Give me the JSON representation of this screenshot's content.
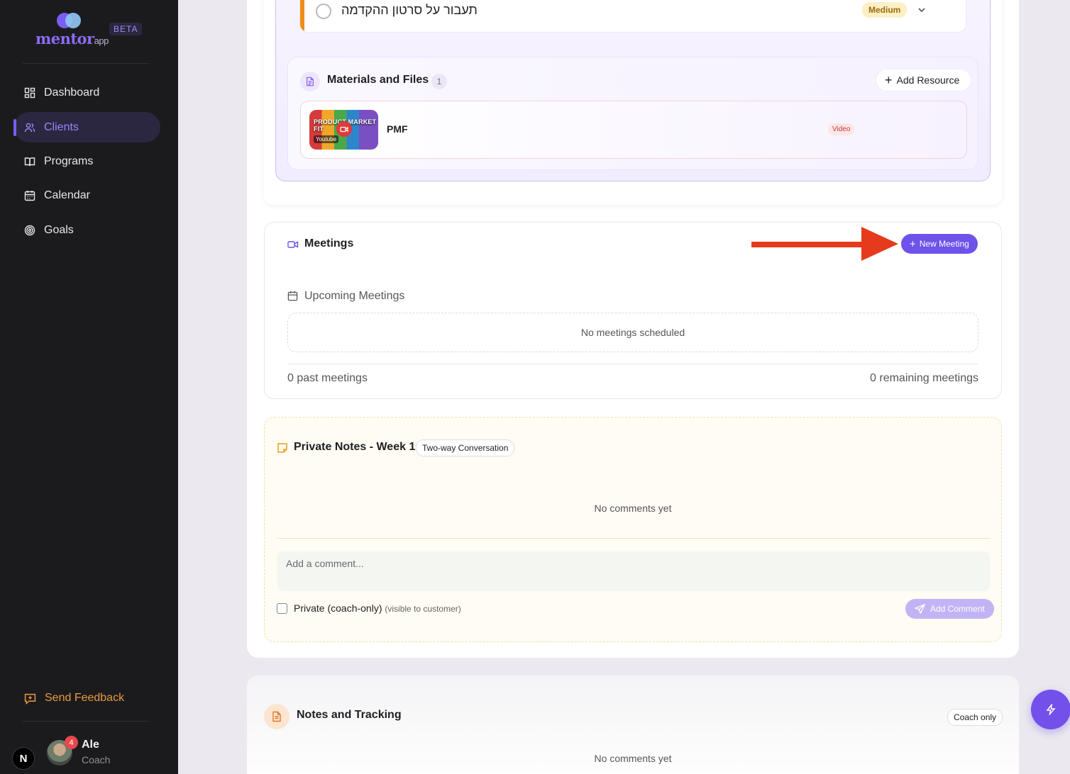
{
  "sidebar": {
    "logo": {
      "brand": "mentor",
      "suffix": "app"
    },
    "beta_label": "BETA",
    "items": [
      {
        "label": "Dashboard",
        "icon": "dashboard-icon",
        "active": false
      },
      {
        "label": "Clients",
        "icon": "users-icon",
        "active": true
      },
      {
        "label": "Programs",
        "icon": "book-icon",
        "active": false
      },
      {
        "label": "Calendar",
        "icon": "calendar-icon",
        "active": false
      },
      {
        "label": "Goals",
        "icon": "target-icon",
        "active": false
      }
    ],
    "feedback_label": "Send Feedback",
    "user": {
      "name": "Ale",
      "role": "Coach",
      "notifications": "4"
    },
    "framework_mark": "N"
  },
  "task": {
    "title": "תעבור על סרטון ההקדמה",
    "priority": "Medium"
  },
  "materials": {
    "title": "Materials and Files",
    "count": "1",
    "add_label": "Add Resource",
    "resources": [
      {
        "name": "PMF",
        "type": "Video",
        "thumb_text": "PRODUCT MARKET FIT",
        "thumb_source": "Youtube"
      }
    ]
  },
  "meetings": {
    "title": "Meetings",
    "new_label": "New Meeting",
    "upcoming_title": "Upcoming Meetings",
    "empty_text": "No meetings scheduled",
    "past_text": "0 past meetings",
    "remaining_text": "0 remaining meetings"
  },
  "private_notes": {
    "title": "Private Notes - Week 1",
    "badge": "Two-way Conversation",
    "empty_text": "No comments yet",
    "comment_placeholder": "Add a comment...",
    "private_label": "Private (coach-only)",
    "private_sub": "(visible to customer)",
    "add_comment_label": "Add Comment"
  },
  "notes_tracking": {
    "title": "Notes and Tracking",
    "badge": "Coach only",
    "empty_text": "No comments yet"
  },
  "colors": {
    "accent": "#6f52ea",
    "sidebar_bg": "#1b1b1e",
    "feedback": "#e89b3c",
    "annotation_arrow": "#e63a1c"
  }
}
